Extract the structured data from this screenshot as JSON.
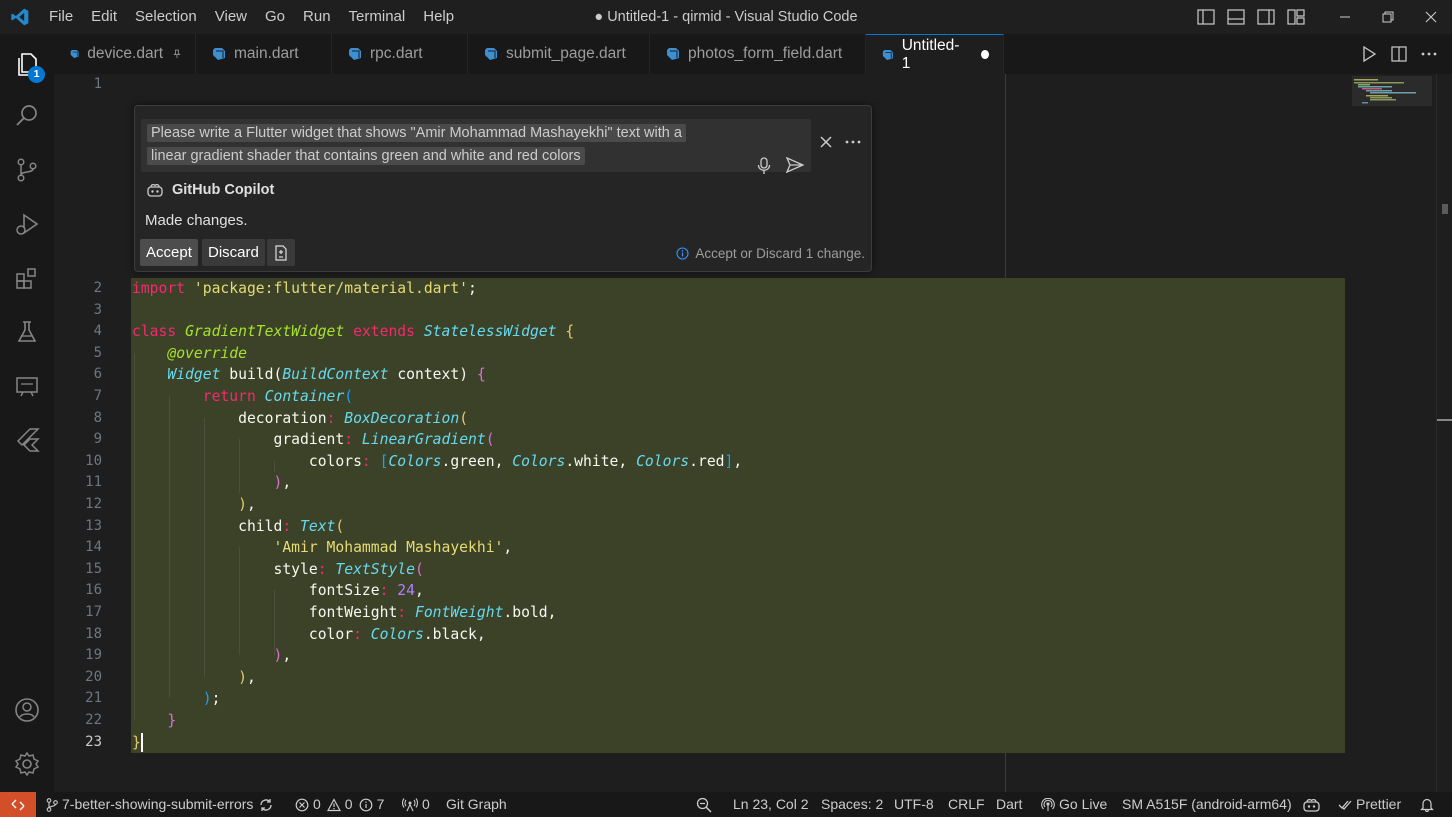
{
  "titlebar": {
    "menu": [
      "File",
      "Edit",
      "Selection",
      "View",
      "Go",
      "Run",
      "Terminal",
      "Help"
    ],
    "title": "● Untitled-1 - qirmid - Visual Studio Code"
  },
  "activity": {
    "explorer_badge": "1"
  },
  "tabs": [
    {
      "label": "device.dart"
    },
    {
      "label": "main.dart"
    },
    {
      "label": "rpc.dart"
    },
    {
      "label": "submit_page.dart"
    },
    {
      "label": "photos_form_field.dart"
    },
    {
      "label": "Untitled-1"
    }
  ],
  "editor": {
    "line_numbers": [
      "1",
      "2",
      "3",
      "4",
      "5",
      "6",
      "7",
      "8",
      "9",
      "10",
      "11",
      "12",
      "13",
      "14",
      "15",
      "16",
      "17",
      "18",
      "19",
      "20",
      "21",
      "22",
      "23"
    ]
  },
  "chat": {
    "prompt_line1": "Please write a Flutter widget that shows \"Amir Mohammad Mashayekhi\" text with a",
    "prompt_line2": "linear gradient shader that contains green and white and red colors",
    "agent": "GitHub Copilot",
    "response": "Made changes.",
    "accept": "Accept",
    "discard": "Discard",
    "status": "Accept or Discard 1 change."
  },
  "statusbar": {
    "branch": "7-better-showing-submit-errors",
    "errors": "0",
    "warnings": "0",
    "infos": "7",
    "ports": "0",
    "git_graph": "Git Graph",
    "position": "Ln 23, Col 2",
    "spaces": "Spaces: 2",
    "encoding": "UTF-8",
    "eol": "CRLF",
    "language": "Dart",
    "go_live": "Go Live",
    "device": "SM A515F (android-arm64)",
    "prettier": "Prettier"
  },
  "colors": {
    "accent": "#0078d4",
    "diff_insert_bg": "#3b4228",
    "remote_indicator": "#d24f2a"
  }
}
